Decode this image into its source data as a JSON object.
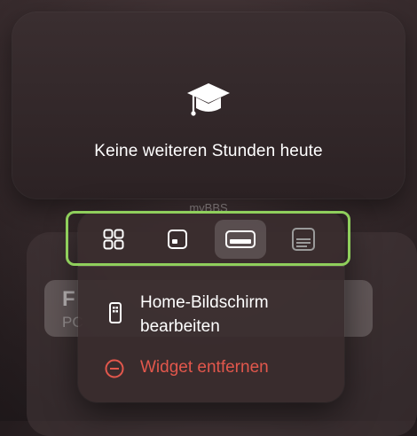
{
  "widget": {
    "icon": "graduation-cap-icon",
    "message": "Keine weiteren Stunden heute"
  },
  "app_name": "myBBS",
  "background_card": {
    "title_fragment": "F",
    "subtitle_fragment": "PC"
  },
  "size_options": [
    {
      "icon": "small-grid-icon",
      "selected": false
    },
    {
      "icon": "small-widget-icon",
      "selected": false
    },
    {
      "icon": "medium-widget-icon",
      "selected": true
    },
    {
      "icon": "large-widget-icon",
      "selected": false
    }
  ],
  "menu": {
    "edit_home": {
      "label": "Home-Bildschirm bearbeiten",
      "line1": "Home-Bildschirm",
      "line2": "bearbeiten",
      "icon": "phone-icon"
    },
    "remove_widget": {
      "label": "Widget entfernen",
      "icon": "minus-circle-icon"
    }
  },
  "colors": {
    "highlight_border": "#8fcf5c",
    "destructive": "#e2574c"
  }
}
